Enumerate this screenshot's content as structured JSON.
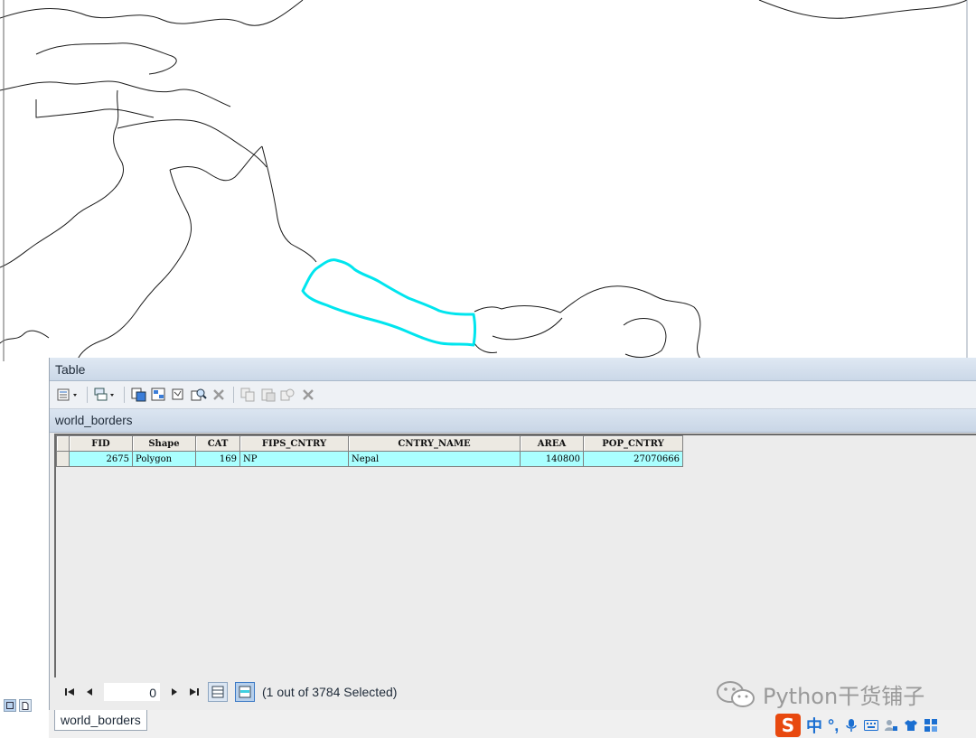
{
  "window": {
    "title": "Table"
  },
  "table_tab": {
    "label": "world_borders"
  },
  "columns": [
    "FID",
    "Shape",
    "CAT",
    "FIPS_CNTRY",
    "CNTRY_NAME",
    "AREA",
    "POP_CNTRY"
  ],
  "rows": [
    {
      "FID": "2675",
      "Shape": "Polygon",
      "CAT": "169",
      "FIPS_CNTRY": "NP",
      "CNTRY_NAME": "Nepal",
      "AREA": "140800",
      "POP_CNTRY": "27070666"
    }
  ],
  "navigation": {
    "current_record": "0",
    "status": "(1 out of 3784 Selected)"
  },
  "bottom_tab": {
    "label": "world_borders"
  },
  "watermark": {
    "text": "Python干货铺子"
  },
  "ime": {
    "logo": "S",
    "mode": "中",
    "punct": "°,"
  },
  "colors": {
    "selection_highlight": "#00E5EE",
    "selected_row": "#AAFFFF"
  },
  "icons": {
    "toolbar": [
      "table-options-icon",
      "related-tables-icon",
      "select-by-attributes-icon",
      "switch-selection-icon",
      "clear-selection-icon",
      "zoom-to-selected-icon",
      "delete-selected-icon",
      "copy-selected-icon",
      "paste-icon",
      "zoom-icon",
      "close-icon"
    ],
    "ime": [
      "microphone-icon",
      "keyboard-icon",
      "user-icon",
      "shirt-icon",
      "grid-icon"
    ]
  }
}
